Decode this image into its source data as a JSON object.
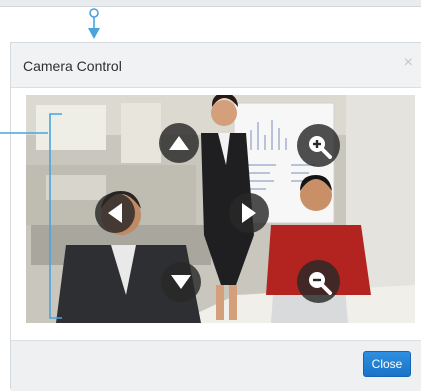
{
  "dialog": {
    "title": "Camera Control",
    "close_glyph": "×"
  },
  "footer": {
    "close_label": "Close"
  },
  "controls": {
    "pan_up": "arrow-up-icon",
    "pan_down": "arrow-down-icon",
    "pan_left": "arrow-left-icon",
    "pan_right": "arrow-right-icon",
    "zoom_in": "zoom-in-icon",
    "zoom_out": "zoom-out-icon"
  },
  "colors": {
    "accent": "#1a73c8",
    "callout": "#4aa3df",
    "control_bg": "#282828"
  }
}
